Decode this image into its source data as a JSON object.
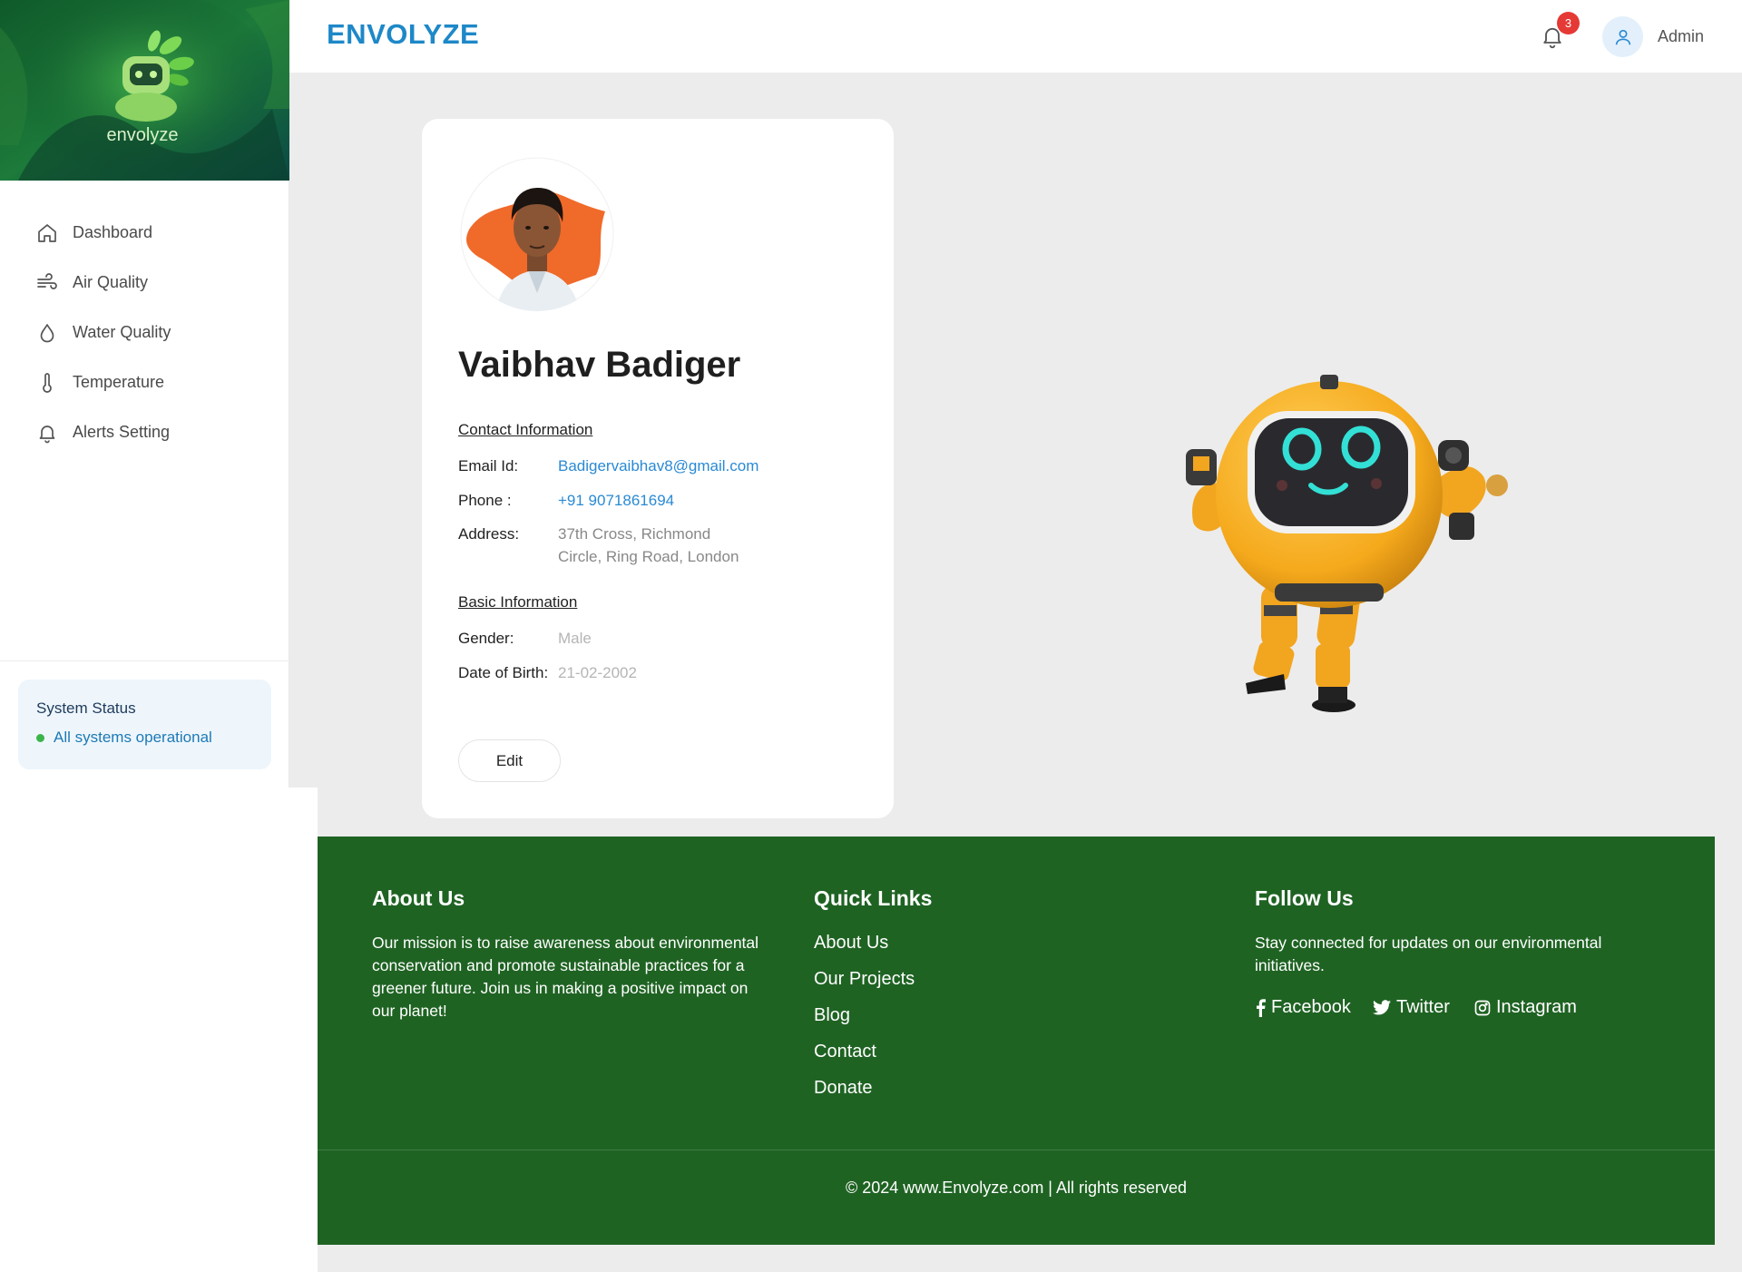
{
  "brand": {
    "logo_text": "envolyze",
    "name": "ENVOLYZE"
  },
  "sidebar": {
    "items": [
      {
        "label": "Dashboard",
        "icon": "home-icon"
      },
      {
        "label": "Air Quality",
        "icon": "wind-icon"
      },
      {
        "label": "Water Quality",
        "icon": "droplet-icon"
      },
      {
        "label": "Temperature",
        "icon": "thermometer-icon"
      },
      {
        "label": "Alerts Setting",
        "icon": "bell-icon"
      }
    ],
    "status": {
      "title": "System Status",
      "text": "All systems operational",
      "color": "#3bb54a"
    }
  },
  "header": {
    "notifications": "3",
    "user": "Admin"
  },
  "profile": {
    "name": "Vaibhav Badiger",
    "contact_title": "Contact Information",
    "email_label": "Email Id:",
    "email": "Badigervaibhav8@gmail.com",
    "phone_label": "Phone :",
    "phone": "+91 9071861694",
    "address_label": "Address:",
    "address_line1": "37th Cross, Richmond",
    "address_line2": "Circle, Ring Road, London",
    "basic_title": "Basic Information",
    "gender_label": "Gender:",
    "gender": "Male",
    "dob_label": "Date of Birth:",
    "dob": "21-02-2002",
    "edit_label": "Edit"
  },
  "footer": {
    "about_title": "About Us",
    "about_text": "Our mission is to raise awareness about environmental conservation and promote sustainable practices for a greener future. Join us in making a positive impact on our planet!",
    "links_title": "Quick Links",
    "links": [
      "About Us",
      "Our Projects",
      "Blog",
      "Contact",
      "Donate"
    ],
    "follow_title": "Follow Us",
    "follow_text": "Stay connected for updates on our environmental initiatives.",
    "social": [
      "Facebook",
      "Twitter",
      "Instagram"
    ],
    "copyright": "© 2024 www.Envolyze.com | All rights reserved"
  },
  "colors": {
    "footer_bg": "#1f6323",
    "brand": "#1e88c8",
    "link": "#2a8ad4",
    "badge": "#e53935"
  }
}
